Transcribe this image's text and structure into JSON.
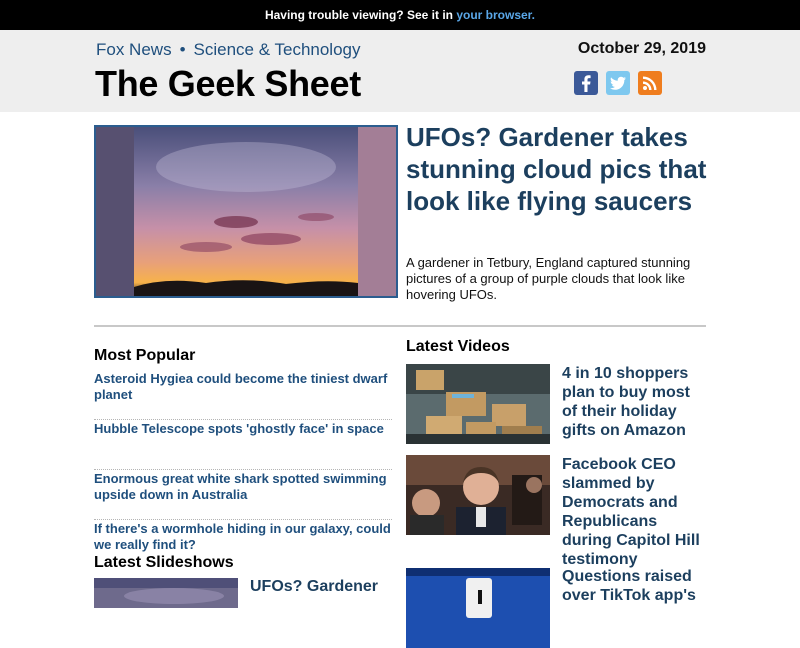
{
  "topbar": {
    "text": "Having trouble viewing? See it in ",
    "link": "your browser."
  },
  "header": {
    "nav_primary": "Fox News",
    "nav_separator": "•",
    "nav_secondary": "Science & Technology",
    "title": "The Geek Sheet",
    "date": "October 29, 2019",
    "social": [
      "facebook-icon",
      "twitter-icon",
      "rss-icon"
    ]
  },
  "hero": {
    "headline": "UFOs? Gardener takes stunning cloud pics that look like flying saucers",
    "description": "A gardener in Tetbury, England captured stunning pictures of a group of purple clouds that look like hovering UFOs."
  },
  "most_popular": {
    "heading": "Most Popular",
    "items": [
      "Asteroid Hygiea could become the tiniest dwarf planet",
      "Hubble Telescope spots 'ghostly face' in space",
      "Enormous great white shark spotted swimming upside down in Australia",
      "If there's a wormhole hiding in our galaxy, could we really find it?"
    ]
  },
  "latest_videos": {
    "heading": "Latest Videos",
    "items": [
      "4 in 10 shoppers plan to buy most of their holiday gifts on Amazon",
      "Facebook CEO slammed by Democrats and Republicans during Capitol Hill testimony",
      "Questions raised over TikTok app's"
    ]
  },
  "latest_slideshows": {
    "heading": "Latest Slideshows",
    "items": [
      "UFOs? Gardener"
    ]
  },
  "colors": {
    "link_blue": "#1f4f7d",
    "headline_navy": "#1c3f5e",
    "browser_link": "#5aa7e8"
  }
}
